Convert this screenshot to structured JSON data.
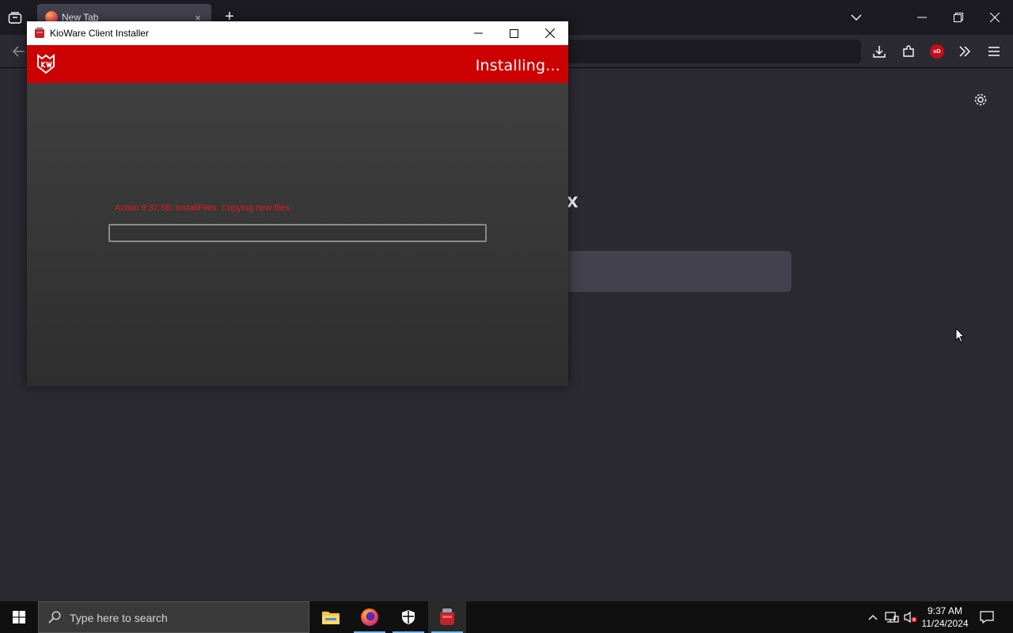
{
  "browser": {
    "tab": {
      "title": "New Tab",
      "favicon": "firefox-icon",
      "close_glyph": "×"
    },
    "new_tab_glyph": "+",
    "new_tab_logo_fragment": "x",
    "toolbar_icons": [
      "download-icon",
      "extensions-icon",
      "ublock-origin-icon",
      "overflow-chevrons-icon",
      "menu-icon"
    ],
    "ublock_badge": "uD",
    "settings_icon": "gear-icon"
  },
  "installer": {
    "title": "KioWare Client Installer",
    "status": "Installing...",
    "action_text": "Action 9:37:56: InstallFiles. Copying new files.",
    "progress": 0,
    "brand_color": "#cc0000",
    "action_color": "#e31b1b"
  },
  "taskbar": {
    "search_placeholder": "Type here to search",
    "apps": [
      "file-explorer-icon",
      "firefox-icon",
      "windows-security-icon",
      "kioware-installer-icon"
    ],
    "time": "9:37 AM",
    "date": "11/24/2024"
  }
}
